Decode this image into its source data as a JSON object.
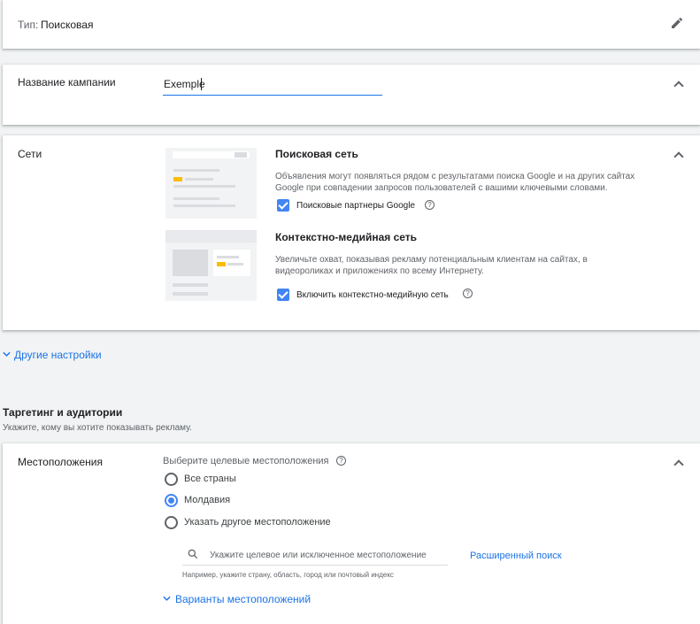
{
  "type_row": {
    "label": "Тип:",
    "value": "Поисковая"
  },
  "campaign_name": {
    "label": "Название кампании",
    "value": "Exemple"
  },
  "networks": {
    "label": "Сети",
    "search": {
      "title": "Поисковая сеть",
      "description": "Объявления могут появляться рядом с результатами поиска Google и на других сайтах Google при совпадении запросов пользователей с вашими ключевыми словами.",
      "checkbox_label": "Поисковые партнеры Google",
      "checked": true
    },
    "display": {
      "title": "Контекстно-медийная сеть",
      "description": "Увеличьте охват, показывая рекламу потенциальным клиентам на сайтах, в видеороликах и приложениях по всему Интернету.",
      "checkbox_label": "Включить контекстно-медийную сеть",
      "checked": true
    }
  },
  "other_settings": "Другие настройки",
  "targeting": {
    "title": "Таргетинг и аудитории",
    "subtitle": "Укажите, кому вы хотите показывать рекламу."
  },
  "locations": {
    "label": "Местоположения",
    "prompt": "Выберите целевые местоположения",
    "options": [
      "Все страны",
      "Молдавия",
      "Указать другое местоположение"
    ],
    "selected": "Молдавия",
    "search_placeholder": "Укажите целевое или исключенное местоположение",
    "advanced_search": "Расширенный поиск",
    "hint": "Например, укажите страну, область, город или почтовый индекс",
    "variants": "Варианты местоположений"
  },
  "icons": {
    "edit": "pencil-icon",
    "collapse": "chevron-up-icon",
    "expand": "chevron-down-icon",
    "help": "question-circle-icon",
    "search": "magnifier-icon"
  },
  "colors": {
    "accent": "#4285f4",
    "link": "#1a73e8",
    "highlight": "#fbbc04"
  }
}
